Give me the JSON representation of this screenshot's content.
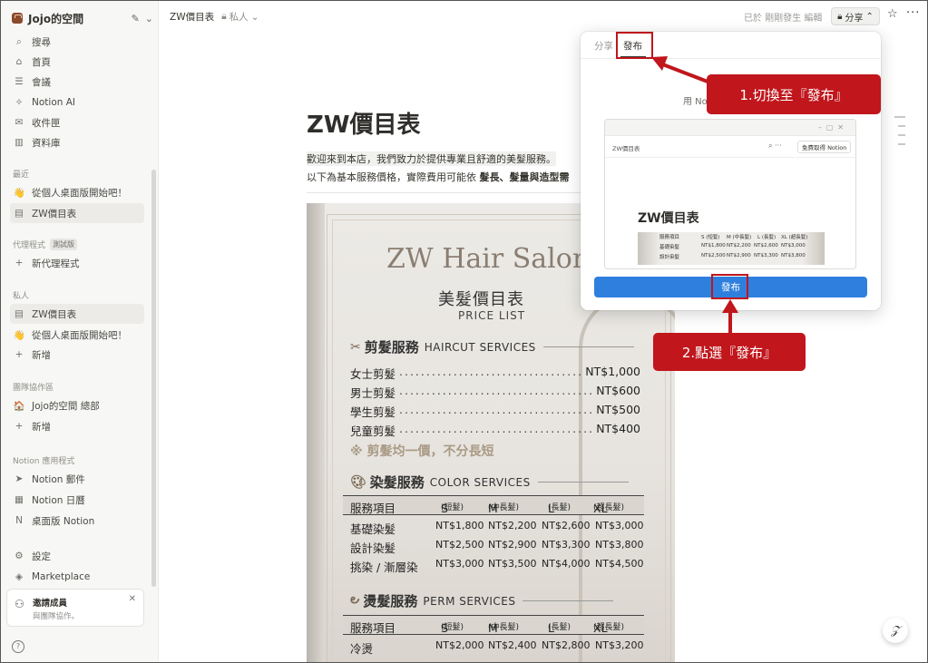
{
  "sidebar": {
    "workspace": "Jojo的空間",
    "nav": [
      "搜尋",
      "首頁",
      "會議",
      "Notion AI",
      "收件匣",
      "資料庫"
    ],
    "recent_label": "最近",
    "recent": [
      "從個人桌面版開始吧！",
      "ZW價目表"
    ],
    "agents_label": "代理程式",
    "agents_beta": "測試版",
    "agents_new": "新代理程式",
    "private_label": "私人",
    "private": [
      "ZW價目表",
      "從個人桌面版開始吧！",
      "新增"
    ],
    "team_label": "團隊協作區",
    "team": [
      "Jojo的空間 總部",
      "新增"
    ],
    "apps_label": "Notion 應用程式",
    "apps": [
      "Notion 郵件",
      "Notion 日曆",
      "桌面版 Notion"
    ],
    "settings": "設定",
    "marketplace": "Marketplace",
    "invite_title": "邀請成員",
    "invite_sub": "與團隊協作。"
  },
  "topbar": {
    "breadcrumb": "ZW價目表",
    "privacy": "私人",
    "edited": "已於 剛剛發生 編輯",
    "share": "分享"
  },
  "page": {
    "title": "ZW價目表",
    "intro_line1": "歡迎來到本店，我們致力於提供專業且舒適的美髮服務。",
    "intro_line2_prefix": "以下為基本服務價格，實際費用可能依 ",
    "intro_line2_bold": "髮長、髮量與造型需"
  },
  "poster": {
    "salon": "ZW Hair Salon",
    "title": "美髮價目表",
    "subtitle": "PRICE LIST",
    "haircut": {
      "zh": "剪髮服務",
      "en": "HAIRCUT SERVICES",
      "rows": [
        [
          "女士剪髮",
          "NT$1,000"
        ],
        [
          "男士剪髮",
          "NT$600"
        ],
        [
          "學生剪髮",
          "NT$500"
        ],
        [
          "兒童剪髮",
          "NT$400"
        ]
      ],
      "note": "※ 剪髮均一價，不分長短"
    },
    "color": {
      "zh": "染髮服務",
      "en": "COLOR SERVICES",
      "head": [
        "服務項目",
        "S",
        "(短髮)",
        "M",
        "(中長髮)",
        "L",
        "(長髮)",
        "XL",
        "(超長髮)"
      ],
      "rows": [
        [
          "基礎染髮",
          "NT$1,800",
          "NT$2,200",
          "NT$2,600",
          "NT$3,000"
        ],
        [
          "設計染髮",
          "NT$2,500",
          "NT$2,900",
          "NT$3,300",
          "NT$3,800"
        ],
        [
          "挑染 / 漸層染",
          "NT$3,000",
          "NT$3,500",
          "NT$4,000",
          "NT$4,500"
        ]
      ]
    },
    "perm": {
      "zh": "燙髮服務",
      "en": "PERM SERVICES",
      "head": [
        "服務項目",
        "S",
        "(短髮)",
        "M",
        "(中長髮)",
        "L",
        "(長髮)",
        "XL",
        "(超長髮)"
      ],
      "rows": [
        [
          "冷燙",
          "NT$2,000",
          "NT$2,400",
          "NT$2,800",
          "NT$3,200"
        ]
      ]
    }
  },
  "popup": {
    "tab_share": "分享",
    "tab_publish": "發布",
    "desc": "用 No",
    "preview_name": "ZW價目表",
    "preview_free": "免費取得 Notion",
    "preview_title": "ZW價目表",
    "preview_head": [
      "服務項目",
      "S (短髮)",
      "M (中長髮)",
      "L (長髮)",
      "XL (超長髮)"
    ],
    "preview_rows": [
      [
        "基礎染髮",
        "NT$1,800",
        "NT$2,200",
        "NT$2,600",
        "NT$3,000"
      ],
      [
        "設計染髮",
        "NT$2,500",
        "NT$2,900",
        "NT$3,300",
        "NT$3,800"
      ]
    ],
    "publish_button": "發布"
  },
  "annotations": {
    "step1": "1.切換至『發布』",
    "step2": "2.點選『發布』",
    "color": "#c0161c"
  }
}
